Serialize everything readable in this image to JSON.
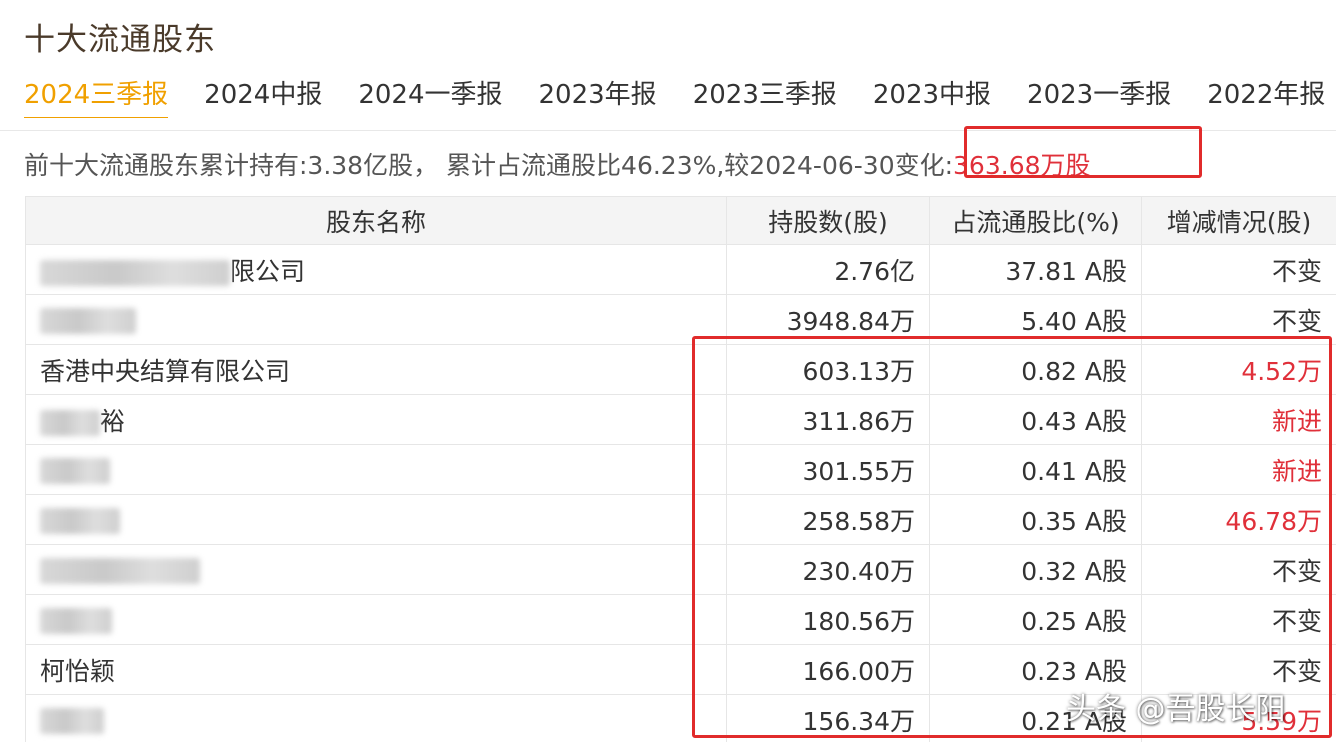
{
  "page": {
    "title": "十大流通股东",
    "tabs": [
      {
        "label": "2024三季报",
        "active": true
      },
      {
        "label": "2024中报",
        "active": false
      },
      {
        "label": "2024一季报",
        "active": false
      },
      {
        "label": "2023年报",
        "active": false
      },
      {
        "label": "2023三季报",
        "active": false
      },
      {
        "label": "2023中报",
        "active": false
      },
      {
        "label": "2023一季报",
        "active": false
      },
      {
        "label": "2022年报",
        "active": false
      }
    ],
    "summary": {
      "prefix": "前十大流通股东累计持有:3.38亿股， 累计占流通股比46.23%,较2024-06-30变化:",
      "change": "363.68万股"
    },
    "table": {
      "headers": [
        "股东名称",
        "持股数(股)",
        "占流通股比(%)",
        "增减情况(股)"
      ],
      "rows": [
        {
          "name": "限公司",
          "name_redacted": true,
          "shares": "2.76亿",
          "ratio": "37.81 A股",
          "change": "不变",
          "change_up": false
        },
        {
          "name": "",
          "name_redacted": true,
          "shares": "3948.84万",
          "ratio": "5.40 A股",
          "change": "不变",
          "change_up": false
        },
        {
          "name": "香港中央结算有限公司",
          "name_redacted": false,
          "shares": "603.13万",
          "ratio": "0.82 A股",
          "change": "4.52万",
          "change_up": true
        },
        {
          "name": "裕",
          "name_redacted": true,
          "shares": "311.86万",
          "ratio": "0.43 A股",
          "change": "新进",
          "change_up": true
        },
        {
          "name": "",
          "name_redacted": true,
          "shares": "301.55万",
          "ratio": "0.41 A股",
          "change": "新进",
          "change_up": true
        },
        {
          "name": "",
          "name_redacted": true,
          "shares": "258.58万",
          "ratio": "0.35 A股",
          "change": "46.78万",
          "change_up": true
        },
        {
          "name": "",
          "name_redacted": true,
          "shares": "230.40万",
          "ratio": "0.32 A股",
          "change": "不变",
          "change_up": false
        },
        {
          "name": "",
          "name_redacted": true,
          "shares": "180.56万",
          "ratio": "0.25 A股",
          "change": "不变",
          "change_up": false
        },
        {
          "name": "柯怡颖",
          "name_redacted": false,
          "shares": "166.00万",
          "ratio": "0.23 A股",
          "change": "不变",
          "change_up": false
        },
        {
          "name": "",
          "name_redacted": true,
          "shares": "156.34万",
          "ratio": "0.21 A股",
          "change": "5.59万",
          "change_up": true
        }
      ]
    },
    "watermark": "头条 @吾股长阳"
  },
  "colors": {
    "accent": "#f0a000",
    "increase": "#e0303a",
    "annotation_box": "#e12b2b",
    "header_bg": "#f4f4f4"
  }
}
